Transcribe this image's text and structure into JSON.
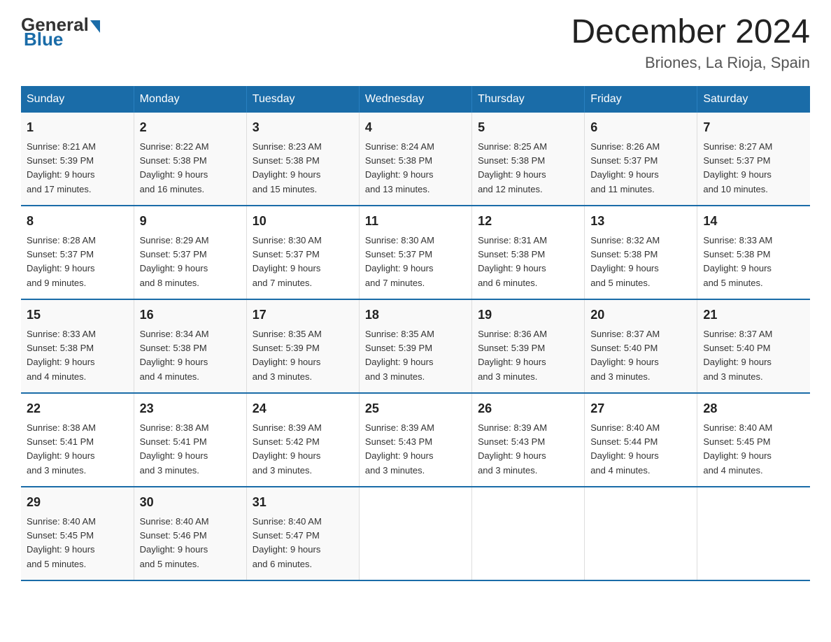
{
  "header": {
    "logo_general": "General",
    "logo_blue": "Blue",
    "month_title": "December 2024",
    "location": "Briones, La Rioja, Spain"
  },
  "days_of_week": [
    "Sunday",
    "Monday",
    "Tuesday",
    "Wednesday",
    "Thursday",
    "Friday",
    "Saturday"
  ],
  "weeks": [
    [
      {
        "day": "1",
        "sunrise": "8:21 AM",
        "sunset": "5:39 PM",
        "daylight": "9 hours and 17 minutes."
      },
      {
        "day": "2",
        "sunrise": "8:22 AM",
        "sunset": "5:38 PM",
        "daylight": "9 hours and 16 minutes."
      },
      {
        "day": "3",
        "sunrise": "8:23 AM",
        "sunset": "5:38 PM",
        "daylight": "9 hours and 15 minutes."
      },
      {
        "day": "4",
        "sunrise": "8:24 AM",
        "sunset": "5:38 PM",
        "daylight": "9 hours and 13 minutes."
      },
      {
        "day": "5",
        "sunrise": "8:25 AM",
        "sunset": "5:38 PM",
        "daylight": "9 hours and 12 minutes."
      },
      {
        "day": "6",
        "sunrise": "8:26 AM",
        "sunset": "5:37 PM",
        "daylight": "9 hours and 11 minutes."
      },
      {
        "day": "7",
        "sunrise": "8:27 AM",
        "sunset": "5:37 PM",
        "daylight": "9 hours and 10 minutes."
      }
    ],
    [
      {
        "day": "8",
        "sunrise": "8:28 AM",
        "sunset": "5:37 PM",
        "daylight": "9 hours and 9 minutes."
      },
      {
        "day": "9",
        "sunrise": "8:29 AM",
        "sunset": "5:37 PM",
        "daylight": "9 hours and 8 minutes."
      },
      {
        "day": "10",
        "sunrise": "8:30 AM",
        "sunset": "5:37 PM",
        "daylight": "9 hours and 7 minutes."
      },
      {
        "day": "11",
        "sunrise": "8:30 AM",
        "sunset": "5:37 PM",
        "daylight": "9 hours and 7 minutes."
      },
      {
        "day": "12",
        "sunrise": "8:31 AM",
        "sunset": "5:38 PM",
        "daylight": "9 hours and 6 minutes."
      },
      {
        "day": "13",
        "sunrise": "8:32 AM",
        "sunset": "5:38 PM",
        "daylight": "9 hours and 5 minutes."
      },
      {
        "day": "14",
        "sunrise": "8:33 AM",
        "sunset": "5:38 PM",
        "daylight": "9 hours and 5 minutes."
      }
    ],
    [
      {
        "day": "15",
        "sunrise": "8:33 AM",
        "sunset": "5:38 PM",
        "daylight": "9 hours and 4 minutes."
      },
      {
        "day": "16",
        "sunrise": "8:34 AM",
        "sunset": "5:38 PM",
        "daylight": "9 hours and 4 minutes."
      },
      {
        "day": "17",
        "sunrise": "8:35 AM",
        "sunset": "5:39 PM",
        "daylight": "9 hours and 3 minutes."
      },
      {
        "day": "18",
        "sunrise": "8:35 AM",
        "sunset": "5:39 PM",
        "daylight": "9 hours and 3 minutes."
      },
      {
        "day": "19",
        "sunrise": "8:36 AM",
        "sunset": "5:39 PM",
        "daylight": "9 hours and 3 minutes."
      },
      {
        "day": "20",
        "sunrise": "8:37 AM",
        "sunset": "5:40 PM",
        "daylight": "9 hours and 3 minutes."
      },
      {
        "day": "21",
        "sunrise": "8:37 AM",
        "sunset": "5:40 PM",
        "daylight": "9 hours and 3 minutes."
      }
    ],
    [
      {
        "day": "22",
        "sunrise": "8:38 AM",
        "sunset": "5:41 PM",
        "daylight": "9 hours and 3 minutes."
      },
      {
        "day": "23",
        "sunrise": "8:38 AM",
        "sunset": "5:41 PM",
        "daylight": "9 hours and 3 minutes."
      },
      {
        "day": "24",
        "sunrise": "8:39 AM",
        "sunset": "5:42 PM",
        "daylight": "9 hours and 3 minutes."
      },
      {
        "day": "25",
        "sunrise": "8:39 AM",
        "sunset": "5:43 PM",
        "daylight": "9 hours and 3 minutes."
      },
      {
        "day": "26",
        "sunrise": "8:39 AM",
        "sunset": "5:43 PM",
        "daylight": "9 hours and 3 minutes."
      },
      {
        "day": "27",
        "sunrise": "8:40 AM",
        "sunset": "5:44 PM",
        "daylight": "9 hours and 4 minutes."
      },
      {
        "day": "28",
        "sunrise": "8:40 AM",
        "sunset": "5:45 PM",
        "daylight": "9 hours and 4 minutes."
      }
    ],
    [
      {
        "day": "29",
        "sunrise": "8:40 AM",
        "sunset": "5:45 PM",
        "daylight": "9 hours and 5 minutes."
      },
      {
        "day": "30",
        "sunrise": "8:40 AM",
        "sunset": "5:46 PM",
        "daylight": "9 hours and 5 minutes."
      },
      {
        "day": "31",
        "sunrise": "8:40 AM",
        "sunset": "5:47 PM",
        "daylight": "9 hours and 6 minutes."
      },
      null,
      null,
      null,
      null
    ]
  ],
  "labels": {
    "sunrise": "Sunrise:",
    "sunset": "Sunset:",
    "daylight": "Daylight:"
  }
}
